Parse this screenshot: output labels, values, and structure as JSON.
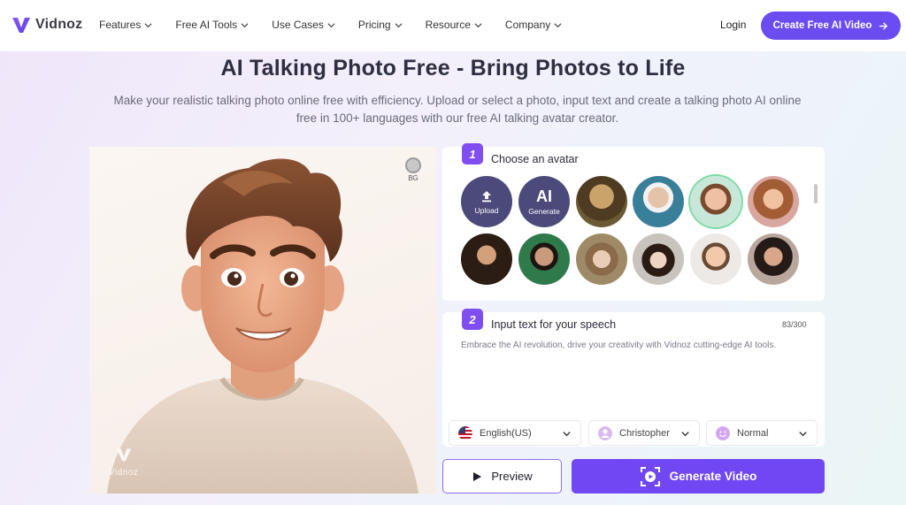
{
  "nav": {
    "logo_text": "Vidnoz",
    "menu": [
      {
        "label": "Features"
      },
      {
        "label": "Free AI Tools"
      },
      {
        "label": "Use Cases"
      },
      {
        "label": "Pricing"
      },
      {
        "label": "Resource"
      },
      {
        "label": "Company"
      }
    ],
    "login": "Login",
    "cta": "Create Free AI Video",
    "cta_icon": "arrow-right-icon"
  },
  "hero": {
    "title": "AI Talking Photo Free - Bring Photos to Life",
    "subtitle": "Make your realistic talking photo online free with efficiency. Upload or select a photo, input text and create a talking photo AI online free in 100+ languages with our free AI talking avatar creator."
  },
  "preview": {
    "bg_label": "BG",
    "watermark": "Vidnoz"
  },
  "step1": {
    "number": "1",
    "title": "Choose an avatar",
    "upload_icon": "upload-icon",
    "upload_label": "Upload",
    "generate_mark": "AI",
    "generate_label": "Generate",
    "selected_index": 3
  },
  "step2": {
    "number": "2",
    "title": "Input text for your speech",
    "counter": "83/300",
    "text": "Embrace the AI revolution, drive your creativity with Vidnoz cutting-edge AI tools."
  },
  "options": {
    "language": "English(US)",
    "voice": "Christopher",
    "style": "Normal"
  },
  "actions": {
    "preview": "Preview",
    "generate": "Generate Video"
  },
  "colors": {
    "accent": "#7047f2",
    "cta": "#6b4cf0",
    "step": "#7f4df0"
  }
}
